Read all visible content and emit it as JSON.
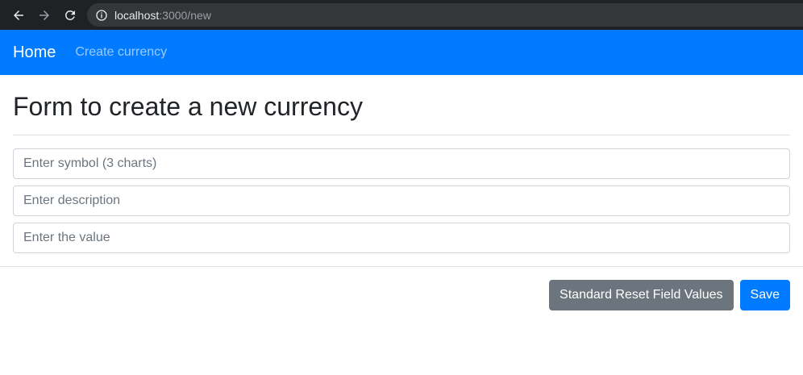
{
  "browser": {
    "url_host": "localhost",
    "url_path": ":3000/new",
    "icons": [
      "back-arrow-icon",
      "forward-arrow-icon",
      "reload-icon",
      "info-icon"
    ]
  },
  "navbar": {
    "brand": "Home",
    "link": "Create currency",
    "color": "#007bff"
  },
  "main": {
    "title": "Form to create a new currency",
    "fields": [
      {
        "placeholder": "Enter symbol (3 charts)",
        "value": ""
      },
      {
        "placeholder": "Enter description",
        "value": ""
      },
      {
        "placeholder": "Enter the value",
        "value": ""
      }
    ]
  },
  "actions": {
    "reset_label": "Standard Reset Field Values",
    "save_label": "Save",
    "reset_color": "#6c757d",
    "save_color": "#007bff"
  }
}
